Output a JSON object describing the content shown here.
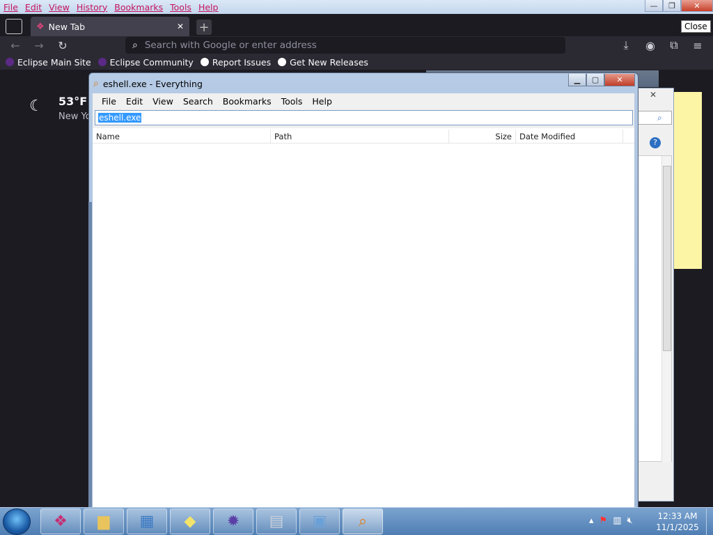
{
  "browser": {
    "menu": [
      "File",
      "Edit",
      "View",
      "History",
      "Bookmarks",
      "Tools",
      "Help"
    ],
    "window_controls": {
      "minimize": "—",
      "restore": "❐",
      "close": "✕"
    },
    "close_tooltip": "Close",
    "tab": {
      "title": "New Tab"
    },
    "urlbar_placeholder": "Search with Google or enter address",
    "bookmarks": [
      "Eclipse Main Site",
      "Eclipse Community",
      "Report Issues",
      "Get New Releases"
    ],
    "weather": {
      "temp": "53°F",
      "location": "New Yo"
    }
  },
  "everything": {
    "title": "eshell.exe - Everything",
    "menu": [
      "File",
      "Edit",
      "View",
      "Search",
      "Bookmarks",
      "Tools",
      "Help"
    ],
    "search_value": "eshell.exe",
    "columns": [
      "Name",
      "Path",
      "Size",
      "Date Modified"
    ]
  },
  "taskbar": {
    "time": "12:33 AM",
    "date": "11/1/2025"
  },
  "colors": {
    "browser_bg": "#1c1b22",
    "selection": "#3399ff",
    "taskbar": "#4f7eb3"
  }
}
